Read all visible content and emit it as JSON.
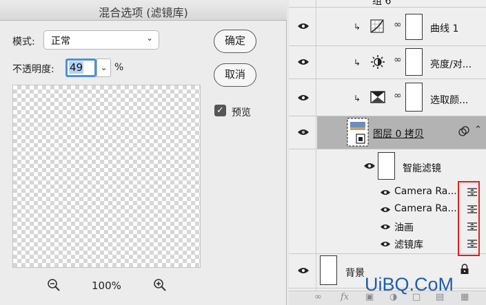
{
  "dialog": {
    "title": "混合选项 (滤镜库)",
    "mode_label": "模式:",
    "mode_value": "正常",
    "opacity_label": "不透明度:",
    "opacity_value": "49",
    "opacity_unit": "%",
    "ok_label": "确定",
    "cancel_label": "取消",
    "preview_label": "预览",
    "preview_checked": true,
    "zoom_level": "100%"
  },
  "layers": {
    "group_name": "组 6",
    "curves_name": "曲线 1",
    "brightness_name": "亮度/对...",
    "selective_color_name": "选取颜...",
    "selected_layer_name": "图层 0 拷贝",
    "smart_filters_label": "智能滤镜",
    "filters": [
      "Camera Ra...",
      "Camera Ra...",
      "油画",
      "滤镜库"
    ],
    "background_name": "背景"
  },
  "bottom_bar": {
    "fx_label": "fx"
  },
  "watermark": "UiBQ.CoM",
  "colors": {
    "highlight_box": "#e41c1c",
    "selection": "#4a90d9"
  }
}
